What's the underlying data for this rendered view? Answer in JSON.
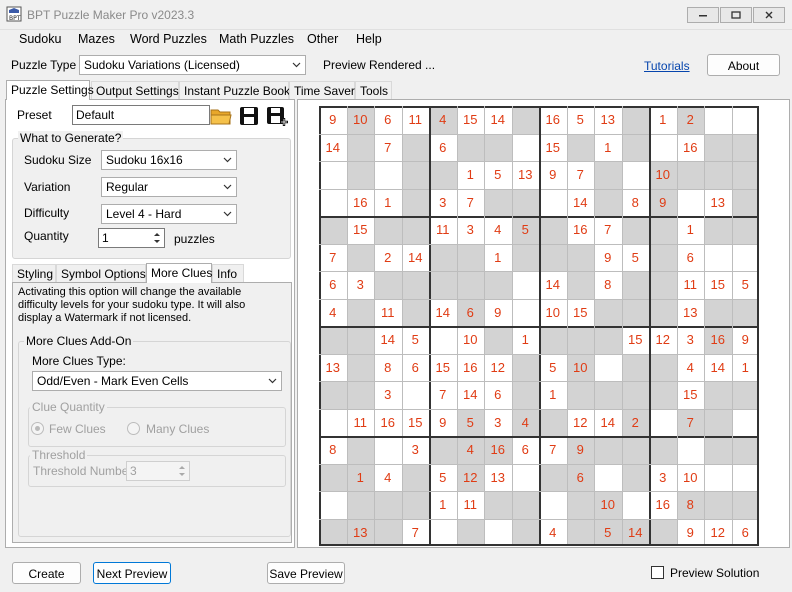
{
  "window": {
    "title": "BPT Puzzle Maker Pro v2023.3"
  },
  "menu": [
    "Sudoku",
    "Mazes",
    "Word Puzzles",
    "Math Puzzles",
    "Other",
    "Help"
  ],
  "toolbar": {
    "puzzle_type_label": "Puzzle Type",
    "puzzle_type_value": "Sudoku Variations (Licensed)",
    "status": "Preview Rendered ...",
    "tutorials_label": "Tutorials",
    "about_label": "About"
  },
  "top_tabs": [
    "Puzzle Settings",
    "Output Settings",
    "Instant Puzzle Books",
    "Time Saver",
    "Tools"
  ],
  "settings": {
    "preset_label": "Preset",
    "preset_value": "Default",
    "what_to_generate_title": "What to Generate?",
    "sudoku_size_label": "Sudoku Size",
    "sudoku_size_value": "Sudoku 16x16",
    "variation_label": "Variation",
    "variation_value": "Regular",
    "difficulty_label": "Difficulty",
    "difficulty_value": "Level 4 - Hard",
    "quantity_label": "Quantity",
    "quantity_value": "1",
    "quantity_unit": "puzzles"
  },
  "sub_tabs": [
    "Styling",
    "Symbol Options",
    "More Clues",
    "Info"
  ],
  "more_clues": {
    "description": "Activating this option will change the available difficulty levels for your sudoku type. It will also display a Watermark if not licensed.",
    "addon_title": "More Clues Add-On",
    "type_label": "More Clues Type:",
    "type_value": "Odd/Even - Mark Even Cells",
    "clue_quantity_title": "Clue Quantity",
    "few_clues_label": "Few Clues",
    "many_clues_label": "Many Clues",
    "threshold_title": "Threshold",
    "threshold_label": "Threshold Number:",
    "threshold_value": "3"
  },
  "buttons": {
    "create": "Create",
    "next_preview": "Next Preview",
    "save_preview": "Save Preview",
    "preview_solution": "Preview Solution"
  },
  "colors": {
    "digit": "#e03c14",
    "shaded": "#d3d3d3",
    "link": "#0645ad"
  },
  "puzzle": {
    "size": 16,
    "shaded": [
      [
        0,
        1,
        0,
        0,
        1,
        0,
        0,
        1,
        0,
        0,
        0,
        1,
        0,
        1,
        0,
        0
      ],
      [
        0,
        1,
        0,
        1,
        0,
        1,
        1,
        0,
        0,
        1,
        0,
        1,
        0,
        0,
        1,
        1
      ],
      [
        0,
        1,
        0,
        1,
        1,
        0,
        0,
        0,
        0,
        0,
        1,
        0,
        1,
        1,
        1,
        1
      ],
      [
        0,
        0,
        0,
        1,
        0,
        0,
        1,
        1,
        0,
        0,
        1,
        0,
        1,
        0,
        0,
        1
      ],
      [
        1,
        0,
        1,
        1,
        0,
        0,
        0,
        1,
        1,
        0,
        0,
        1,
        1,
        0,
        1,
        1
      ],
      [
        0,
        1,
        0,
        0,
        1,
        1,
        0,
        1,
        1,
        1,
        0,
        0,
        1,
        0,
        0,
        0
      ],
      [
        0,
        0,
        1,
        1,
        1,
        1,
        1,
        0,
        0,
        1,
        0,
        1,
        1,
        0,
        0,
        0
      ],
      [
        0,
        1,
        0,
        1,
        0,
        1,
        0,
        0,
        0,
        0,
        1,
        1,
        1,
        0,
        1,
        1
      ],
      [
        1,
        1,
        0,
        0,
        0,
        0,
        1,
        0,
        1,
        1,
        1,
        0,
        0,
        0,
        1,
        0
      ],
      [
        0,
        1,
        0,
        0,
        0,
        0,
        0,
        1,
        0,
        1,
        0,
        1,
        1,
        0,
        0,
        0
      ],
      [
        1,
        1,
        0,
        0,
        0,
        0,
        0,
        1,
        0,
        1,
        1,
        1,
        1,
        0,
        1,
        1
      ],
      [
        0,
        0,
        0,
        0,
        0,
        1,
        0,
        1,
        1,
        0,
        0,
        1,
        0,
        1,
        1,
        0
      ],
      [
        0,
        1,
        0,
        0,
        1,
        1,
        1,
        0,
        0,
        1,
        1,
        1,
        1,
        0,
        1,
        1
      ],
      [
        1,
        1,
        0,
        1,
        0,
        1,
        0,
        0,
        1,
        1,
        0,
        1,
        0,
        0,
        0,
        0
      ],
      [
        0,
        1,
        1,
        1,
        0,
        0,
        1,
        1,
        0,
        1,
        1,
        0,
        0,
        1,
        1,
        1
      ],
      [
        1,
        1,
        1,
        0,
        0,
        1,
        0,
        1,
        0,
        1,
        1,
        1,
        1,
        0,
        0,
        0
      ]
    ],
    "values": [
      [
        "9",
        "10",
        "6",
        "11",
        "4",
        "15",
        "14",
        "",
        "16",
        "5",
        "13",
        "",
        "1",
        "2",
        "",
        ""
      ],
      [
        "14",
        "",
        "7",
        "",
        "6",
        "",
        "",
        "",
        "15",
        "",
        "1",
        "",
        "",
        "16",
        "",
        ""
      ],
      [
        "",
        "",
        "",
        "",
        "",
        "1",
        "5",
        "13",
        "9",
        "7",
        "",
        "",
        "10",
        "",
        "",
        ""
      ],
      [
        "",
        "16",
        "1",
        "",
        "3",
        "7",
        "",
        "",
        "",
        "14",
        "",
        "8",
        "9",
        "",
        "13",
        ""
      ],
      [
        "",
        "15",
        "",
        "",
        "11",
        "3",
        "4",
        "5",
        "",
        "16",
        "7",
        "",
        "",
        "1",
        "",
        ""
      ],
      [
        "7",
        "",
        "2",
        "14",
        "",
        "",
        "1",
        "",
        "",
        "",
        "9",
        "5",
        "",
        "6",
        "",
        ""
      ],
      [
        "6",
        "3",
        "",
        "",
        "",
        "",
        "",
        "",
        "14",
        "",
        "8",
        "",
        "",
        "11",
        "15",
        "5"
      ],
      [
        "4",
        "",
        "11",
        "",
        "14",
        "6",
        "9",
        "",
        "10",
        "15",
        "",
        "",
        "",
        "13",
        "",
        ""
      ],
      [
        "",
        "",
        "14",
        "5",
        "",
        "10",
        "",
        "1",
        "",
        "",
        "",
        "15",
        "12",
        "3",
        "16",
        "9"
      ],
      [
        "13",
        "",
        "8",
        "6",
        "15",
        "16",
        "12",
        "",
        "5",
        "10",
        "",
        "",
        "",
        "4",
        "14",
        "1"
      ],
      [
        "",
        "",
        "3",
        "",
        "7",
        "14",
        "6",
        "",
        "1",
        "",
        "",
        "",
        "",
        "15",
        "",
        ""
      ],
      [
        "",
        "11",
        "16",
        "15",
        "9",
        "5",
        "3",
        "4",
        "",
        "12",
        "14",
        "2",
        "",
        "7",
        "",
        ""
      ],
      [
        "8",
        "",
        "",
        "3",
        "",
        "4",
        "16",
        "6",
        "7",
        "9",
        "",
        "",
        "",
        "",
        "",
        ""
      ],
      [
        "",
        "1",
        "4",
        "",
        "5",
        "12",
        "13",
        "",
        "",
        "6",
        "",
        "",
        "3",
        "10",
        "",
        ""
      ],
      [
        "",
        "",
        "",
        "",
        "1",
        "11",
        "",
        "",
        "",
        "",
        "10",
        "",
        "16",
        "8",
        "",
        ""
      ],
      [
        "",
        "13",
        "",
        "7",
        "",
        "",
        "",
        "",
        "4",
        "",
        "5",
        "14",
        "",
        "9",
        "12",
        "6"
      ]
    ]
  }
}
